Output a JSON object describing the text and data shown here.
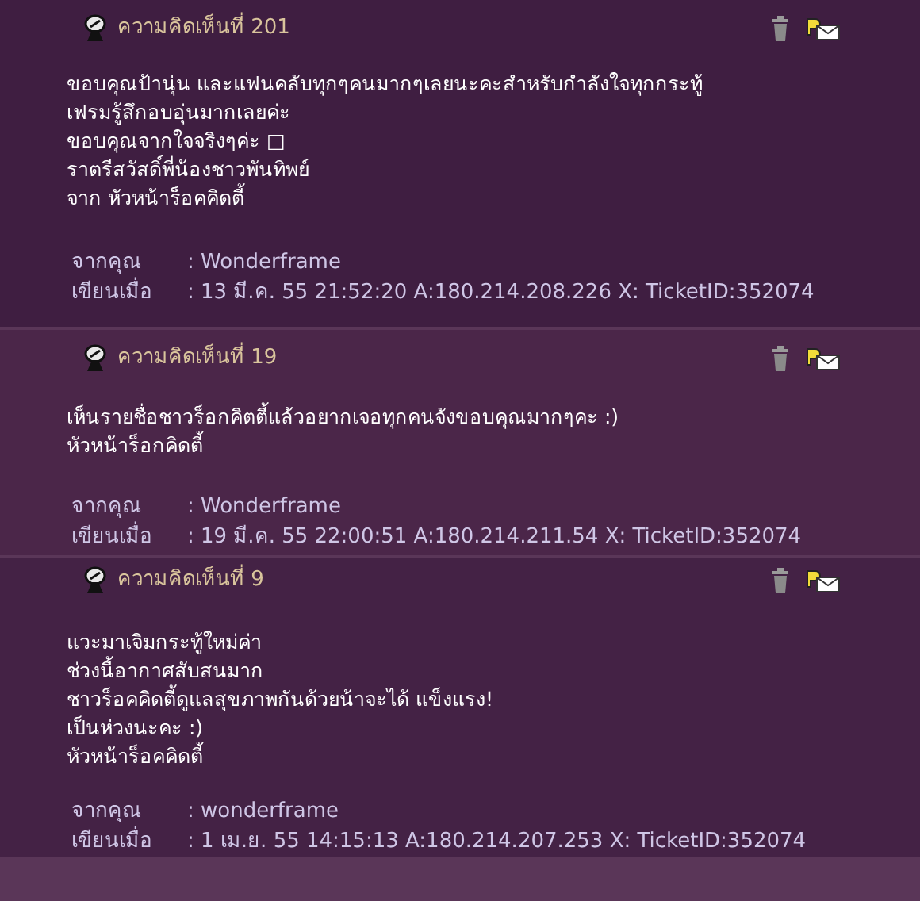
{
  "comments": [
    {
      "title": "ความคิดเห็นที่ 201",
      "body": [
        "ขอบคุณป้านุ่น และแฟนคลับทุกๆคนมากๆเลยนะคะสำหรับกำลังใจทุกกระทู้",
        "เฟรมรู้สึกอบอุ่นมากเลยค่ะ",
        "ขอบคุณจากใจจริงๆค่ะ □",
        "ราตรีสวัสดิ์พี่น้องชาวพันทิพย์",
        "จาก หัวหน้าร็อคคิดตี้"
      ],
      "from_label": "จากคุณ",
      "from": ": Wonderframe",
      "written_label": "เขียนเมื่อ",
      "written": ": 13 มี.ค. 55 21:52:20 A:180.214.208.226 X: TicketID:352074"
    },
    {
      "title": "ความคิดเห็นที่ 19",
      "body": [
        "เห็นรายชื่อชาวร็อกคิตตี้แล้วอยากเจอทุกคนจังขอบคุณมากๆคะ :)",
        "หัวหน้าร็อกคิดตี้"
      ],
      "from_label": "จากคุณ",
      "from": ": Wonderframe",
      "written_label": "เขียนเมื่อ",
      "written": ": 19 มี.ค. 55 22:00:51 A:180.214.211.54 X: TicketID:352074"
    },
    {
      "title": "ความคิดเห็นที่ 9",
      "body": [
        "แวะมาเจิมกระทู้ใหม่ค่า",
        "ช่วงนี้อากาศสับสนมาก",
        "ชาวร็อคคิดตี้ดูแลสุขภาพกันด้วยน้าจะได้ แข็งแรง!",
        "เป็นห่วงนะคะ :)",
        "หัวหน้าร็อคคิดตี้"
      ],
      "from_label": "จากคุณ",
      "from": ": wonderframe",
      "written_label": "เขียนเมื่อ",
      "written": ": 1 เม.ย. 55 14:15:13 A:180.214.207.253 X: TicketID:352074"
    }
  ]
}
